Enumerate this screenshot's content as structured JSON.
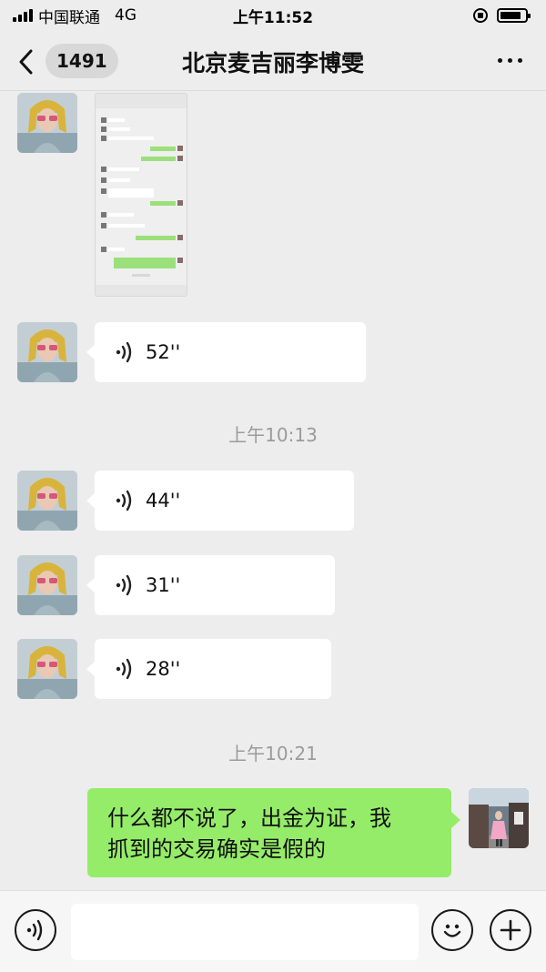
{
  "status_bar": {
    "carrier": "中国联通",
    "network": "4G",
    "time": "上午11:52",
    "battery_level": 0.85
  },
  "nav": {
    "unread_count": "1491",
    "title": "北京麦吉丽李博雯"
  },
  "messages": {
    "voice_1_duration": "52''",
    "timestamp_1": "上午10:13",
    "voice_2_duration": "44''",
    "voice_3_duration": "31''",
    "voice_4_duration": "28''",
    "timestamp_2": "上午10:21",
    "text_line_1": "什么都不说了，出金为证，我",
    "text_line_2": "抓到的交易确实是假的"
  },
  "input": {
    "placeholder": ""
  },
  "colors": {
    "background": "#ededed",
    "outgoing_bubble": "#95ec69",
    "incoming_bubble": "#ffffff",
    "timestamp_text": "#9b9b9b"
  }
}
